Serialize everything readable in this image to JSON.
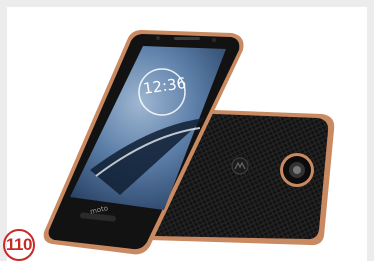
{
  "photo": {
    "subject": "product-photo-smartphone",
    "lock_screen_time": "12:36",
    "front_brand": "moto",
    "colors": {
      "background": "#ececec",
      "panel": "#ffffff",
      "frame_copper": "#c98a62",
      "body_black": "#141414",
      "screen_blue": "#5c7fa6",
      "badge_red": "#c72a27"
    }
  },
  "badge": {
    "label": "110"
  }
}
